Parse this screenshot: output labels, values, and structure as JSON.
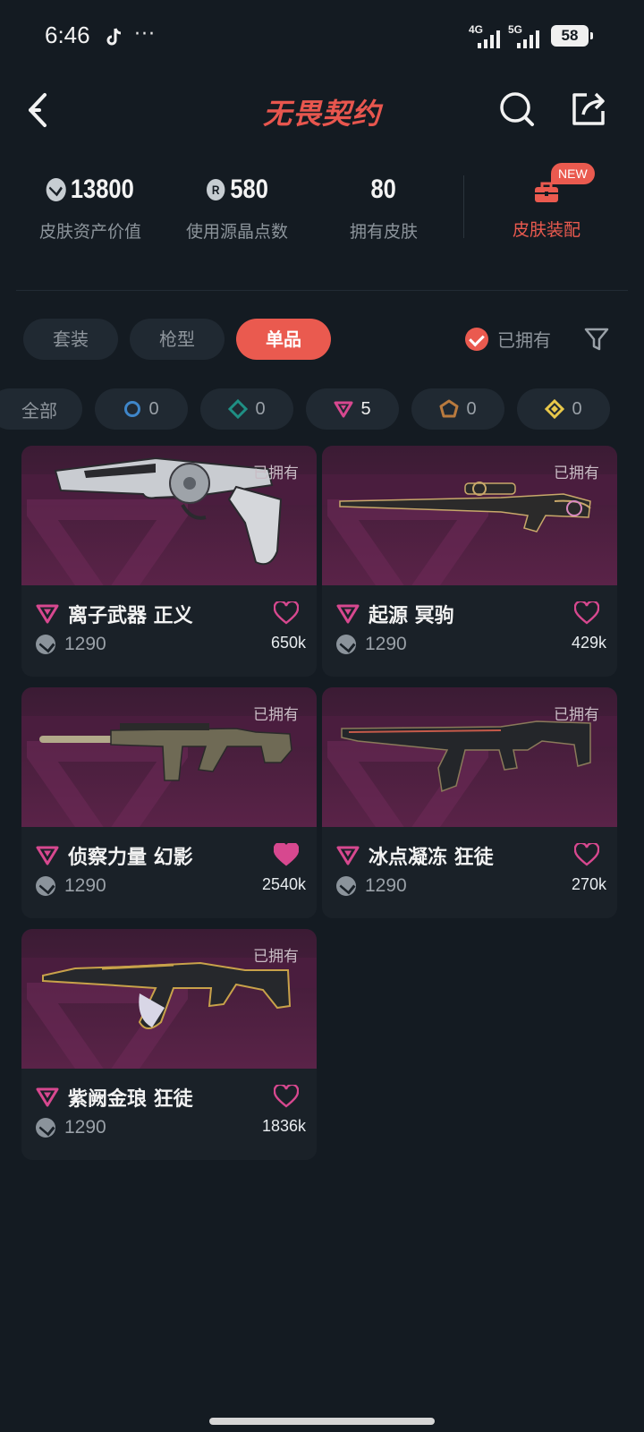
{
  "status_bar": {
    "time": "6:46",
    "more": "···",
    "net1": "4G",
    "net2": "5G",
    "battery": "58"
  },
  "header": {
    "logo": "无畏契约"
  },
  "stats": [
    {
      "value": "13800",
      "label": "皮肤资产价值",
      "icon": "vp-icon"
    },
    {
      "value": "580",
      "label": "使用源晶点数",
      "icon": "radianite-icon"
    },
    {
      "value": "80",
      "label": "拥有皮肤"
    }
  ],
  "outfit": {
    "label": "皮肤装配",
    "badge": "NEW"
  },
  "tabs": [
    {
      "label": "套装",
      "active": false
    },
    {
      "label": "枪型",
      "active": false
    },
    {
      "label": "单品",
      "active": true
    }
  ],
  "owned_filter": {
    "label": "已拥有",
    "checked": true
  },
  "rarity_chips": [
    {
      "label": "全部"
    },
    {
      "tier": "select",
      "count": "0",
      "color": "#3f86c9"
    },
    {
      "tier": "deluxe",
      "count": "0",
      "color": "#1f8f84"
    },
    {
      "tier": "premium",
      "count": "5",
      "color": "#d7488f"
    },
    {
      "tier": "ultra",
      "count": "0",
      "color": "#b97a3e"
    },
    {
      "tier": "exclusive",
      "count": "0",
      "color": "#e8c84a"
    }
  ],
  "items": [
    {
      "name": "离子武器 正义",
      "price": "1290",
      "likes": "650k",
      "owned": "已拥有",
      "liked": false,
      "weapon": "revolver"
    },
    {
      "name": "起源 冥驹",
      "price": "1290",
      "likes": "429k",
      "owned": "已拥有",
      "liked": false,
      "weapon": "sniper"
    },
    {
      "name": "侦察力量 幻影",
      "price": "1290",
      "likes": "2540k",
      "owned": "已拥有",
      "liked": true,
      "weapon": "rifle"
    },
    {
      "name": "冰点凝冻 狂徒",
      "price": "1290",
      "likes": "270k",
      "owned": "已拥有",
      "liked": false,
      "weapon": "ak"
    },
    {
      "name": "紫阙金琅 狂徒",
      "price": "1290",
      "likes": "1836k",
      "owned": "已拥有",
      "liked": false,
      "weapon": "ak-gold"
    }
  ],
  "colors": {
    "accent": "#ea5a4f",
    "background": "#141b22",
    "card": "#1a2128",
    "premium": "#d7488f"
  }
}
